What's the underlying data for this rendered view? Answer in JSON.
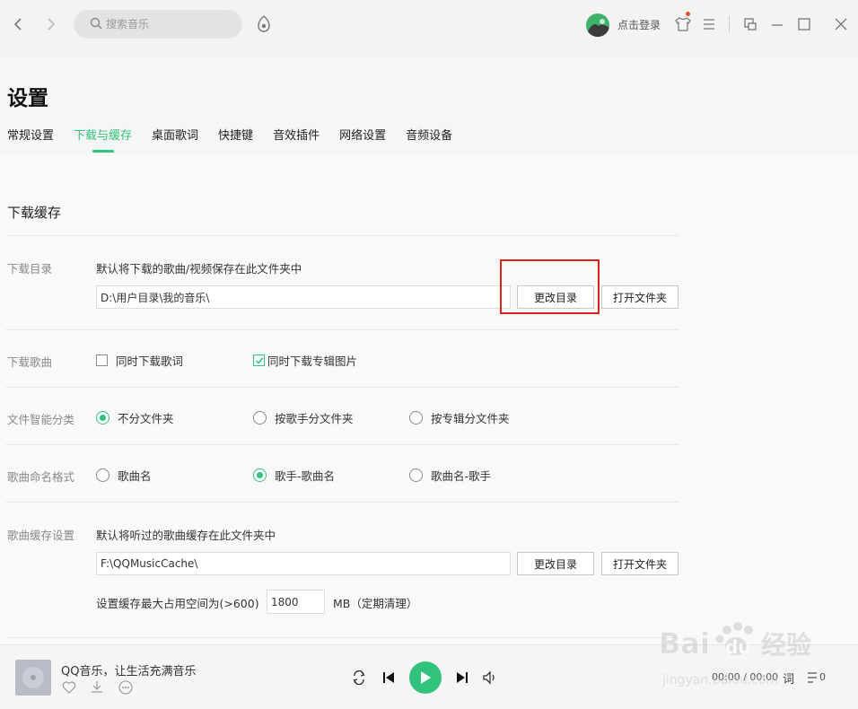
{
  "search": {
    "placeholder": "搜索音乐"
  },
  "header": {
    "login": "点击登录"
  },
  "page": {
    "title": "设置"
  },
  "tabs": [
    {
      "label": "常规设置"
    },
    {
      "label": "下载与缓存"
    },
    {
      "label": "桌面歌词"
    },
    {
      "label": "快捷键"
    },
    {
      "label": "音效插件"
    },
    {
      "label": "网络设置"
    },
    {
      "label": "音频设备"
    }
  ],
  "section": {
    "title": "下载缓存"
  },
  "download_dir": {
    "label": "下载目录",
    "desc": "默认将下载的歌曲/视频保存在此文件夹中",
    "path": "D:\\用户目录\\我的音乐\\",
    "change_btn": "更改目录",
    "open_btn": "打开文件夹"
  },
  "download_song": {
    "label": "下载歌曲",
    "opt_lyrics": "同时下载歌词",
    "opt_cover": "同时下载专辑图片"
  },
  "classify": {
    "label": "文件智能分类",
    "opt1": "不分文件夹",
    "opt2": "按歌手分文件夹",
    "opt3": "按专辑分文件夹"
  },
  "naming": {
    "label": "歌曲命名格式",
    "opt1": "歌曲名",
    "opt2": "歌手-歌曲名",
    "opt3": "歌曲名-歌手"
  },
  "cache": {
    "label": "歌曲缓存设置",
    "desc": "默认将听过的歌曲缓存在此文件夹中",
    "path": "F:\\QQMusicCache\\",
    "change_btn": "更改目录",
    "open_btn": "打开文件夹",
    "max_label": "设置缓存最大占用空间为(>600)",
    "max_value": "1800",
    "max_unit": "MB（定期清理）"
  },
  "player": {
    "song": "QQ音乐，让生活充满音乐",
    "time": "00:00 / 00:00",
    "lyric_btn": "词",
    "playlist_count": "0"
  },
  "watermark": {
    "brand": "Bai du 经验",
    "url": "jingyan.baidu.com"
  },
  "colors": {
    "accent": "#31c27c",
    "highlight": "#e0201b"
  }
}
